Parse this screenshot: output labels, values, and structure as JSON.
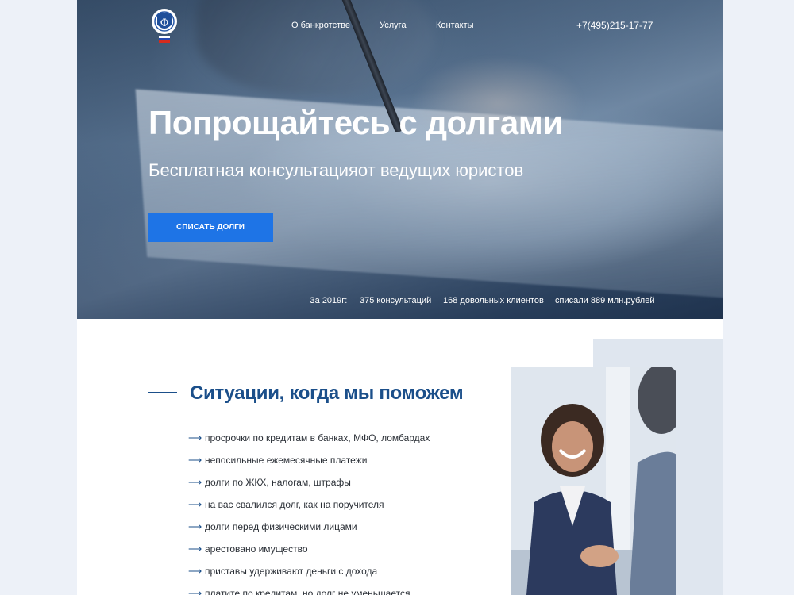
{
  "header": {
    "nav": [
      "О банкротстве",
      "Услуга",
      "Контакты"
    ],
    "phone": "+7(495)215-17-77"
  },
  "hero": {
    "title": "Попрощайтесь с долгами",
    "subtitle": "Бесплатная консультацияот ведущих юристов",
    "cta_label": "СПИСАТЬ ДОЛГИ",
    "stats": [
      "За 2019г:",
      "375 консультаций",
      "168 довольных клиентов",
      "списали 889 млн.рублей"
    ]
  },
  "situations": {
    "title": "Ситуации, когда мы поможем",
    "items": [
      "просрочки по кредитам в банках, МФО, ломбардах",
      "непосильные ежемесячные платежи",
      "долги по ЖКХ, налогам, штрафы",
      "на вас свалился долг, как на поручителя",
      "долги перед физическими лицами",
      "арестовано имущество",
      "приставы удерживают деньги с дохода",
      "платите по кредитам, но долг не уменьшается"
    ]
  },
  "colors": {
    "accent": "#1e74e6",
    "heading": "#1b4f8a",
    "background": "#edf1f8"
  },
  "icons": [
    "logo-emblem",
    "arrow-right-icon"
  ]
}
